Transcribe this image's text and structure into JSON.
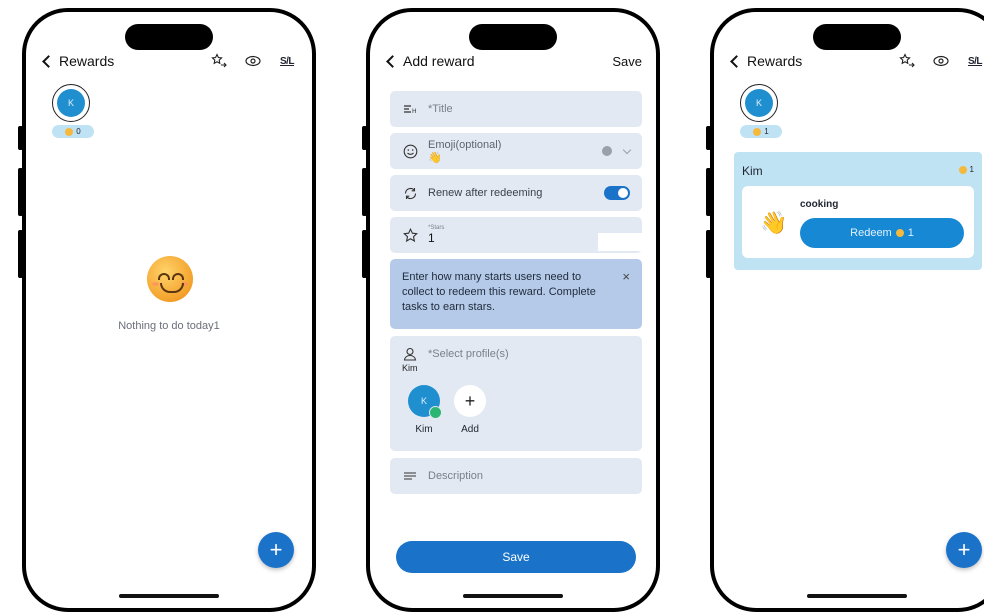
{
  "colors": {
    "accent": "#1a73c9",
    "form_field": "#e3e9f2",
    "info_panel": "#b4cae8",
    "card": "#bfe3f3",
    "avatar": "#1f8fd0",
    "star": "#f5b93e"
  },
  "screen1": {
    "back_label": "Rewards",
    "icons": [
      "star-swap-icon",
      "eye-icon"
    ],
    "sl_label": "S/L",
    "profile": {
      "initial": "K",
      "stars": "0"
    },
    "empty_text": "Nothing to do today1",
    "fab_label": "+"
  },
  "screen2": {
    "back_label": "Add reward",
    "save_link": "Save",
    "title_placeholder": "*Title",
    "emoji_label": "Emoji(optional)",
    "emoji_value": "👋",
    "renew_label": "Renew after redeeming",
    "renew_on": true,
    "stars_label": "*Stars",
    "stars_value": "1",
    "info_text": "Enter how many starts users need to collect to redeem this reward. Complete tasks to earn stars.",
    "info_close": "×",
    "select_profiles_label": "*Select profile(s)",
    "selected_name": "Kim",
    "profiles": [
      {
        "initial": "K",
        "name": "Kim"
      },
      {
        "initial": "+",
        "name": "Add"
      }
    ],
    "description_placeholder": "Description",
    "save_button": "Save"
  },
  "screen3": {
    "back_label": "Rewards",
    "sl_label": "S/L",
    "profile": {
      "initial": "K",
      "stars": "1"
    },
    "card_name": "Kim",
    "card_stars": "1",
    "reward_emoji": "👋",
    "reward_title": "cooking",
    "redeem_label": "Redeem",
    "redeem_stars": "1",
    "fab_label": "+"
  }
}
